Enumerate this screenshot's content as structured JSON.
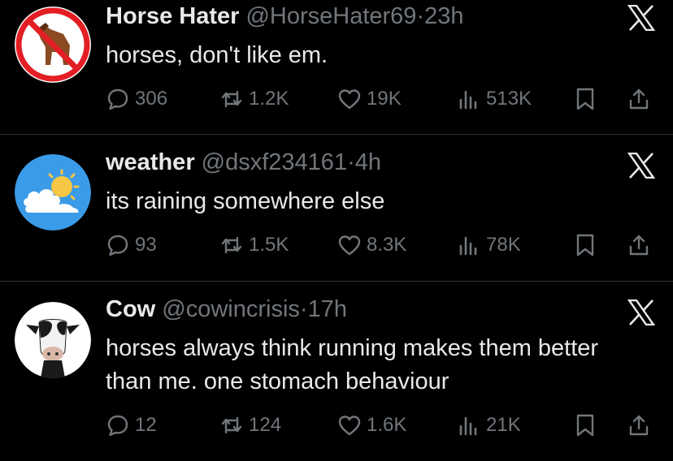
{
  "tweets": [
    {
      "name": "Horse Hater",
      "handle": "@HorseHater69",
      "sep": "·",
      "time": "23h",
      "text": "horses, don't like em.",
      "replies": "306",
      "reposts": "1.2K",
      "likes": "19K",
      "views": "513K",
      "avatar": "horse-prohibited-avatar"
    },
    {
      "name": "weather",
      "handle": "@dsxf234161",
      "sep": "·",
      "time": "4h",
      "text": "its raining somewhere else",
      "replies": "93",
      "reposts": "1.5K",
      "likes": "8.3K",
      "views": "78K",
      "avatar": "sun-cloud-avatar"
    },
    {
      "name": "Cow",
      "handle": "@cowincrisis",
      "sep": "·",
      "time": "17h",
      "text_line1": "horses always think running makes them better",
      "text_line2": "than me. one stomach behaviour",
      "replies": "12",
      "reposts": "124",
      "likes": "1.6K",
      "views": "21K",
      "avatar": "cow-avatar"
    }
  ],
  "colors": {
    "background": "#000000",
    "text": "#e7e9ea",
    "muted": "#71767b",
    "divider": "#2f3336"
  },
  "icons": [
    "reply-icon",
    "repost-icon",
    "like-icon",
    "views-icon",
    "bookmark-icon",
    "share-icon",
    "x-logo-icon"
  ]
}
